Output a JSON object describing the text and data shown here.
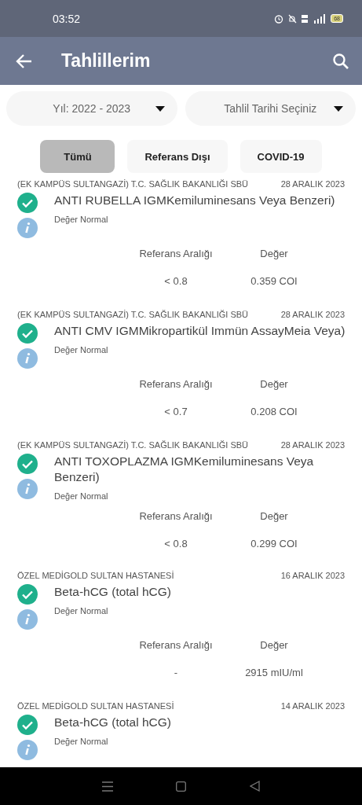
{
  "status_bar": {
    "time": "03:52",
    "battery": "68"
  },
  "app_bar": {
    "title": "Tahlillerim"
  },
  "filters": [
    {
      "label": "Yıl: 2022 - 2023"
    },
    {
      "label": "Tahlil Tarihi Seçiniz"
    }
  ],
  "tabs": [
    {
      "label": "Tümü",
      "selected": true
    },
    {
      "label": "Referans Dışı",
      "selected": false
    },
    {
      "label": "COVID-19",
      "selected": false
    }
  ],
  "results": [
    {
      "hospital": "(EK KAMPÜS SULTANGAZİ) T.C. SAĞLIK BAKANLIĞI SBÜ",
      "date": "28 ARALIK 2023",
      "name": "ANTI RUBELLA IGMKemiluminesans Veya Benzeri)",
      "status": "Değer Normal",
      "range_header": "Referans Aralığı",
      "value_header": "Değer",
      "range": "< 0.8",
      "value": "0.359 COI"
    },
    {
      "hospital": "(EK KAMPÜS SULTANGAZİ) T.C. SAĞLIK BAKANLIĞI SBÜ",
      "date": "28 ARALIK 2023",
      "name": "ANTI CMV IGMMikropartikül Immün AssayMeia Veya)",
      "status": "Değer Normal",
      "range_header": "Referans Aralığı",
      "value_header": "Değer",
      "range": "< 0.7",
      "value": "0.208 COI"
    },
    {
      "hospital": "(EK KAMPÜS SULTANGAZİ) T.C. SAĞLIK BAKANLIĞI SBÜ",
      "date": "28 ARALIK 2023",
      "name": "ANTI TOXOPLAZMA IGMKemiluminesans Veya Benzeri)",
      "status": "Değer Normal",
      "range_header": "Referans Aralığı",
      "value_header": "Değer",
      "range": "< 0.8",
      "value": "0.299 COI"
    },
    {
      "hospital": "ÖZEL MEDİGOLD SULTAN HASTANESİ",
      "date": "16 ARALIK 2023",
      "name": "Beta-hCG (total hCG)",
      "status": "Değer Normal",
      "range_header": "Referans Aralığı",
      "value_header": "Değer",
      "range": "-",
      "value": "2915 mIU/ml"
    },
    {
      "hospital": "ÖZEL MEDİGOLD SULTAN HASTANESİ",
      "date": "14 ARALIK 2023",
      "name": "Beta-hCG (total hCG)",
      "status": "Değer Normal"
    }
  ]
}
